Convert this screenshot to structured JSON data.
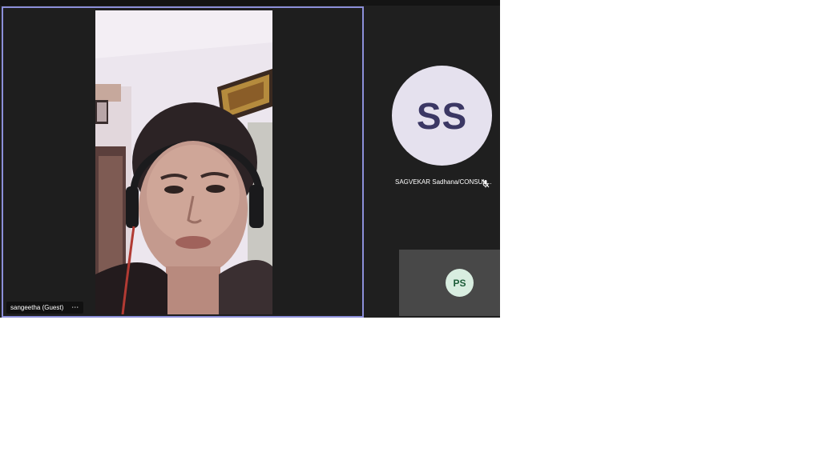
{
  "main_participant": {
    "name": "sangeetha (Guest)",
    "more_icon": "more-options-icon",
    "more_glyph": "⋯"
  },
  "participant_ss": {
    "initials": "SS",
    "name": "SAGVEKAR Sadhana/CONSUL...",
    "mic_icon": "mic-off-icon"
  },
  "self_view": {
    "initials": "PS"
  },
  "colors": {
    "meeting_background": "#1f1f1f",
    "active_speaker_border": "#8c8fd9",
    "ss_avatar_bg": "#e5e1ee",
    "ss_avatar_text": "#3b3764",
    "ps_avatar_bg": "#d8ede0",
    "ps_avatar_text": "#1d5c39",
    "self_tile_bg": "#484848"
  }
}
